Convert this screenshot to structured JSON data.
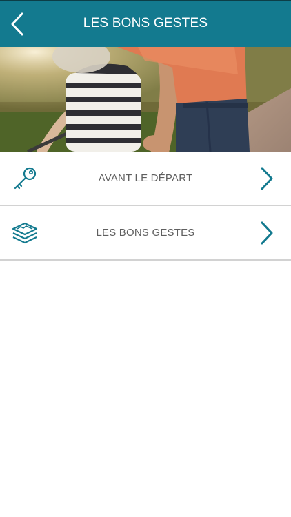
{
  "header": {
    "title": "LES BONS GESTES",
    "back_icon": "chevron-left-icon"
  },
  "hero": {
    "image": "parent-teaching-child-cycling-photo"
  },
  "menu": {
    "items": [
      {
        "label": "AVANT LE DÉPART",
        "icon": "key-icon"
      },
      {
        "label": "LES BONS GESTES",
        "icon": "layers-icon"
      }
    ]
  },
  "colors": {
    "header_bg": "#137a8f",
    "accent": "#137a8f",
    "label_text": "#5f5f5f",
    "divider": "#d2d2d2"
  }
}
